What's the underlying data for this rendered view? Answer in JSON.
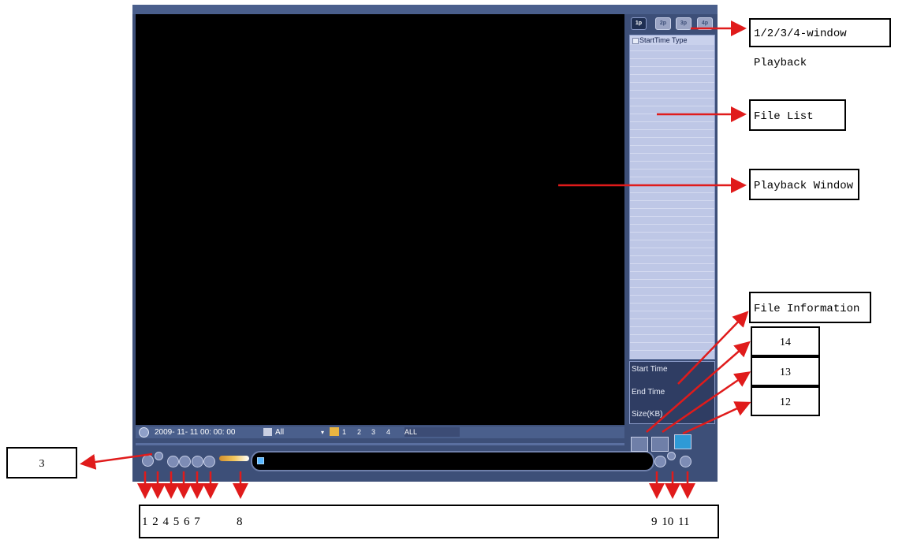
{
  "playback_ui": {
    "window_tabs": [
      "1p",
      "2p",
      "3p",
      "4p"
    ],
    "file_list_header": "StartTime Type",
    "file_info": {
      "start_time": "Start Time",
      "end_time": "End Time",
      "size": "Size(KB)"
    },
    "bottom_bar": {
      "datetime": "2009- 11- 11 00: 00: 00",
      "type_value": "All",
      "channels": [
        "1",
        "2",
        "3",
        "4"
      ],
      "channel_all": "ALL"
    }
  },
  "callouts": {
    "window_playback": "1/2/3/4-window Playback",
    "file_list": "File List",
    "playback_window": "Playback Window",
    "file_information": "File Information",
    "n14": "14",
    "n13": "13",
    "n12": "12",
    "n3": "3"
  },
  "bottom_numbers": {
    "left": "1 2 4 5 6 7",
    "eight": "8",
    "right": "9 10 11"
  },
  "colors": {
    "arrow": "#e01b1b",
    "panel": "#3d4f78"
  }
}
